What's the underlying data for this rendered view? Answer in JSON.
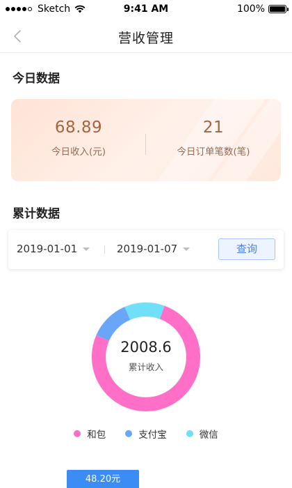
{
  "status_bar": {
    "carrier": "Sketch",
    "time": "9:41 AM",
    "battery": "100%",
    "battery_level": 1.0
  },
  "nav": {
    "title": "营收管理",
    "back_icon": "chevron-left-icon"
  },
  "today": {
    "section_title": "今日数据",
    "income_value": "68.89",
    "income_label": "今日收入(元)",
    "orders_value": "21",
    "orders_label": "今日订单笔数(笔)"
  },
  "total": {
    "section_title": "累计数据",
    "start_date": "2019-01-01",
    "end_date": "2019-01-07",
    "query_label": "查询"
  },
  "chart_data": {
    "type": "pie",
    "center_value": "2008.6",
    "center_label": "累计收入",
    "series": [
      {
        "name": "和包",
        "fraction": 0.76,
        "color": "#ff6ec7"
      },
      {
        "name": "支付宝",
        "fraction": 0.12,
        "color": "#6aa6f8"
      },
      {
        "name": "微信",
        "fraction": 0.12,
        "color": "#6fe0f7"
      }
    ],
    "legend_placement": "bottom"
  },
  "tooltip": {
    "text": "48.20元"
  },
  "colors": {
    "accent": "#4a80e0",
    "card_text": "#a4653f",
    "tooltip_bg": "#3b8cf5"
  }
}
